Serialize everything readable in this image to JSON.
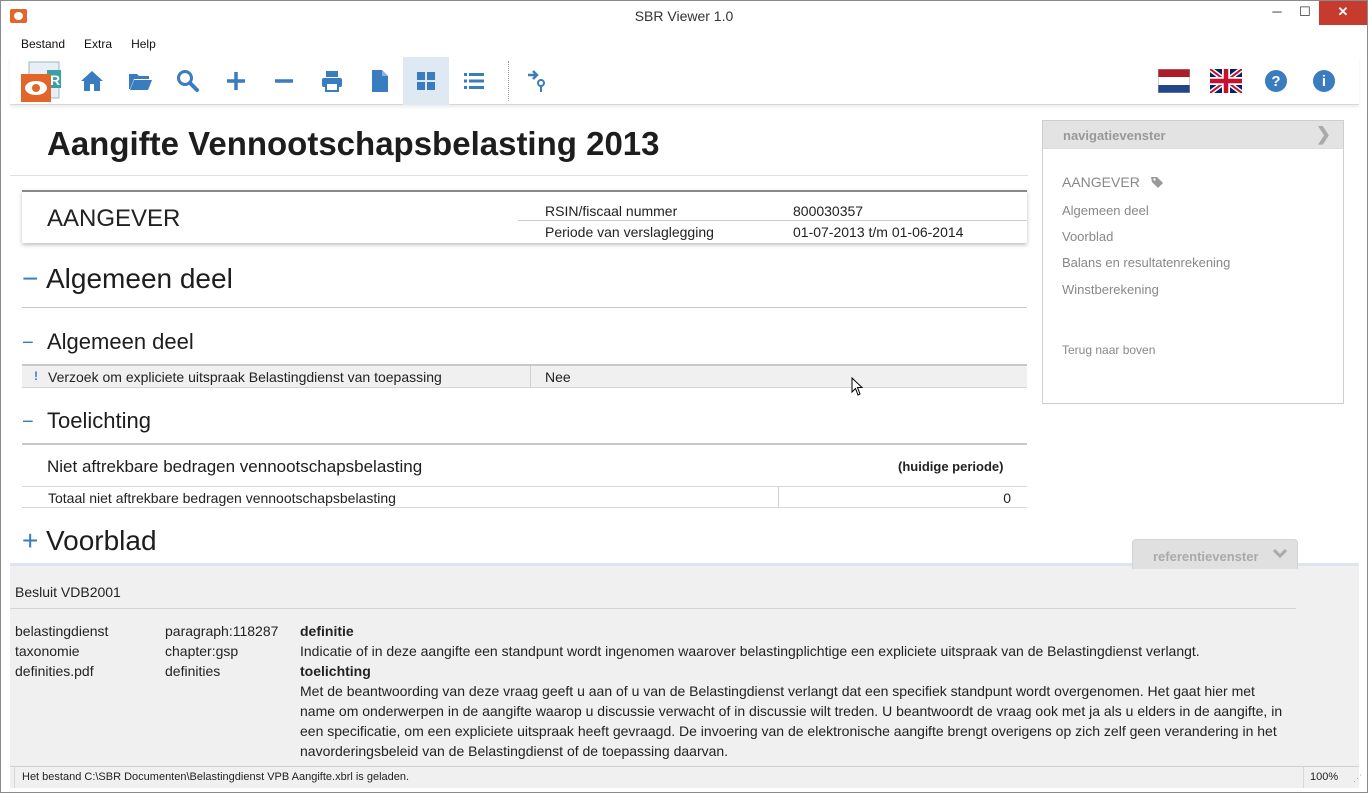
{
  "window": {
    "title": "SBR Viewer 1.0",
    "min": "─",
    "max": "☐",
    "close": "✕"
  },
  "menu": [
    "Bestand",
    "Extra",
    "Help"
  ],
  "toolbar": {
    "icons": [
      "home-icon",
      "open-folder-icon",
      "search-icon",
      "zoom-in-icon",
      "zoom-out-icon",
      "print-icon",
      "document-icon",
      "grid-view-icon",
      "list-view-icon",
      "navigate-icon"
    ],
    "accent": "#3a7cc0"
  },
  "document": {
    "title": "Aangifte Vennootschapsbelasting 2013",
    "aangever": {
      "label": "AANGEVER",
      "rows": [
        {
          "key": "RSIN/fiscaal nummer",
          "value": "800030357"
        },
        {
          "key": "Periode van verslaglegging",
          "value": "01-07-2013 t/m 01-06-2014"
        }
      ]
    },
    "section_main": {
      "symbol": "−",
      "title": "Algemeen deel"
    },
    "section_sub": {
      "symbol": "−",
      "title": "Algemeen deel"
    },
    "question": {
      "info": "!",
      "text": "Verzoek om expliciete uitspraak Belastingdienst van toepassing",
      "answer": "Nee"
    },
    "section_toelichting": {
      "symbol": "−",
      "title": "Toelichting"
    },
    "nab": {
      "title": "Niet aftrekbare bedragen vennootschapsbelasting",
      "period": "(huidige periode)",
      "total_label": "Totaal niet aftrekbare bedragen vennootschapsbelasting",
      "total_value": "0"
    },
    "section_voorblad": {
      "symbol": "+",
      "title": "Voorblad"
    }
  },
  "navpane": {
    "title": "navigatievenster",
    "chevron": "❯",
    "items": [
      "AANGEVER",
      "Algemeen deel",
      "Voorblad",
      "Balans en resultatenrekening",
      "Winstberekening"
    ],
    "back": "Terug naar boven"
  },
  "refpane": {
    "tab": "referentievenster",
    "chevron": "⌄",
    "source": "Besluit VDB2001",
    "col1": [
      "belastingdienst",
      "taxonomie",
      "definities.pdf"
    ],
    "col2": [
      "paragraph:118287",
      "chapter:gsp",
      "definities"
    ],
    "def_head": "definitie",
    "def_text": "Indicatie of in deze aangifte een standpunt wordt ingenomen waarover belastingplichtige een expliciete uitspraak van de Belastingdienst verlangt.",
    "toel_head": "toelichting",
    "toel_text": "Met de beantwoording van deze vraag geeft u aan of u van de Belastingdienst verlangt dat een specifiek standpunt wordt overgenomen. Het gaat hier met name om onderwerpen in de aangifte waarop u discussie verwacht of in discussie wilt treden. U beantwoordt de vraag ook met ja als u elders in de aangifte, in een specificatie, om een expliciete uitspraak heeft gevraagd. De invoering van de elektronische aangifte brengt overigens op zich zelf geen verandering in het navorderingsbeleid van de Belastingdienst of de toepassing daarvan."
  },
  "status": {
    "message": "Het bestand C:\\SBR Documenten\\Belastingdienst VPB Aangifte.xbrl is geladen.",
    "zoom": "100%"
  }
}
